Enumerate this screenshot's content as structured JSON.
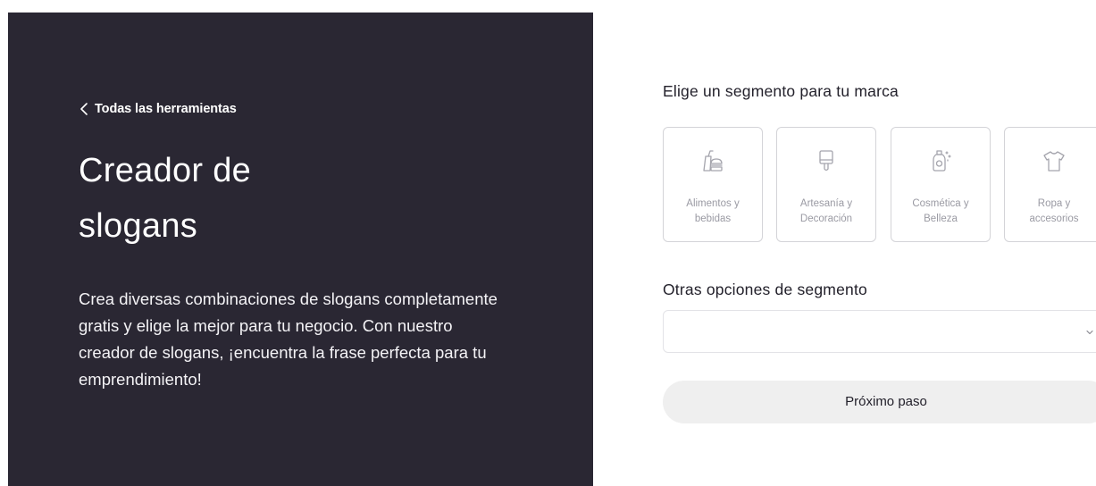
{
  "hero": {
    "back_link": "Todas las herramientas",
    "title_line1": "Creador de",
    "title_line2": "slogans",
    "description": "Crea diversas combinaciones de slogans completamente gratis y elige la mejor para tu negocio. Con nuestro creador de slogans, ¡encuentra la frase perfecta para tu emprendimiento!",
    "background_color": "#2a2733"
  },
  "form": {
    "segment_label": "Elige un segmento para tu marca",
    "segments": [
      {
        "line1": "Alimentos y",
        "line2": "bebidas",
        "icon": "food-icon"
      },
      {
        "line1": "Artesanía y",
        "line2": "Decoración",
        "icon": "brush-icon"
      },
      {
        "line1": "Cosmética y",
        "line2": "Belleza",
        "icon": "cosmetics-icon"
      },
      {
        "line1": "Ropa y",
        "line2": "accesorios",
        "icon": "tshirt-icon"
      }
    ],
    "other_label": "Otras opciones de segmento",
    "other_select_value": "",
    "next_button": "Próximo paso"
  }
}
